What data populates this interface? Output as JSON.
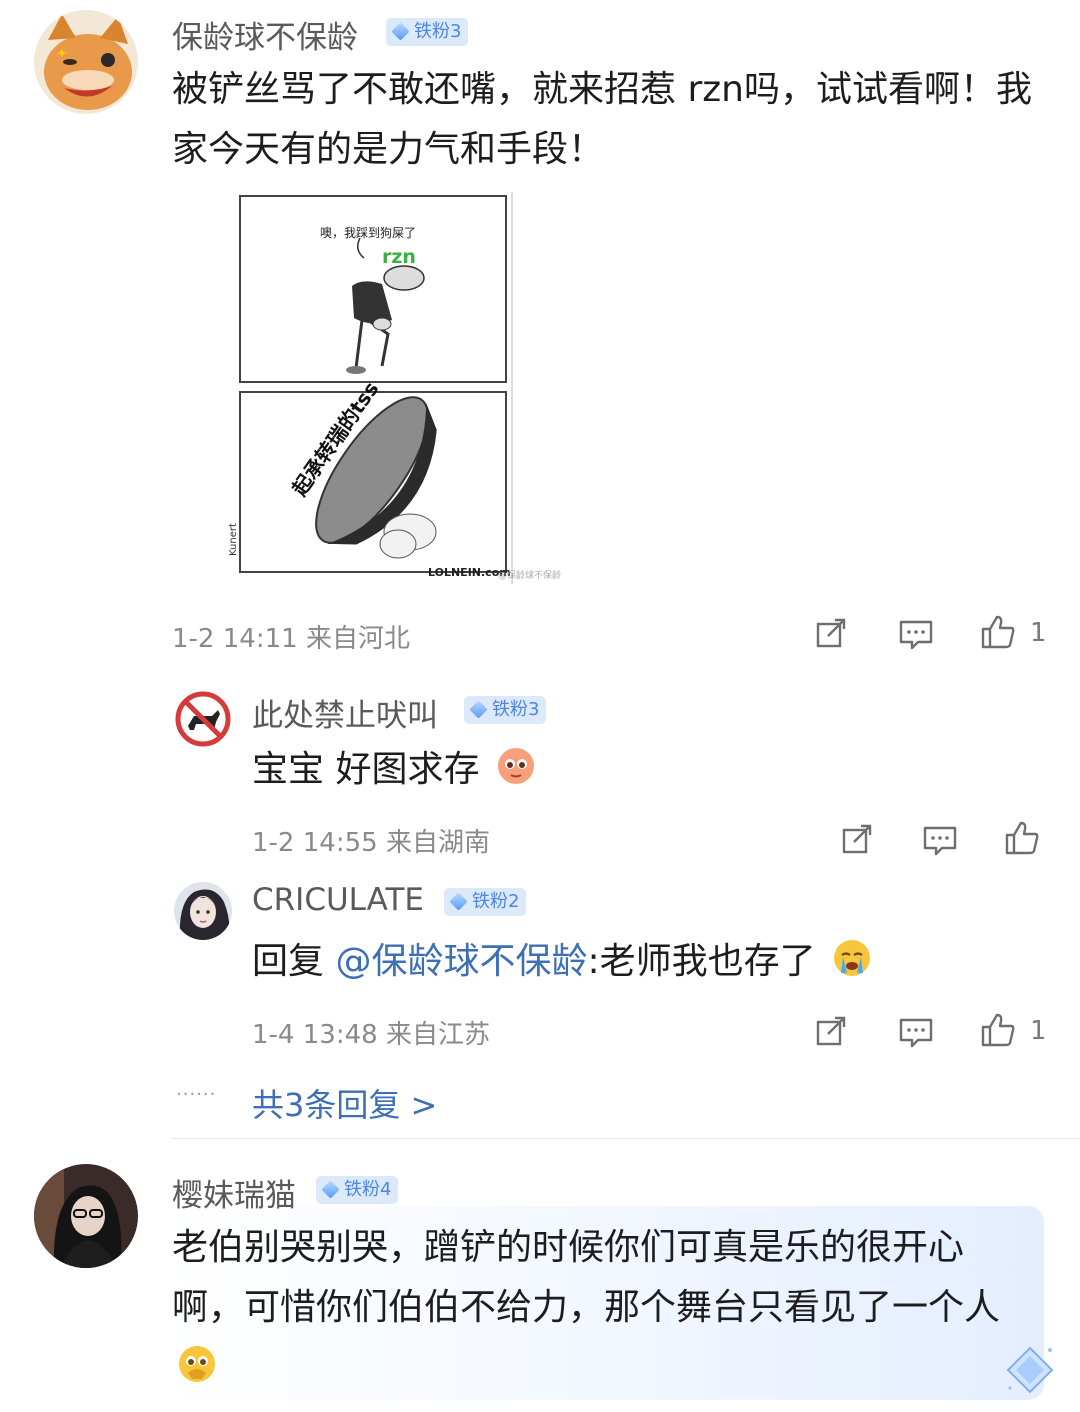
{
  "comments": [
    {
      "name": "保龄球不保龄",
      "badge": "铁粉3",
      "text": "被铲丝骂了不敢还嘴，就来招惹 rzn吗，试试看啊！我家今天有的是力气和手段！",
      "time": "1-2 14:11",
      "location": "来自河北",
      "likes": "1",
      "image": {
        "panel1_speech": "噢，我踩到狗屎了",
        "panel1_tag": "rzn",
        "panel2_shoe": "起承转瑞的tss",
        "signature": "Kunert",
        "site": "LOLNEIN.com",
        "watermark": "@保龄球不保龄"
      }
    },
    {
      "name": "樱妹瑞猫",
      "badge": "铁粉4",
      "text": "老伯别哭别哭，蹭铲的时候你们可真是乐的很开心啊，可惜你们伯伯不给力，那个舞台只看见了一个人"
    }
  ],
  "replies": [
    {
      "name": "此处禁止吠叫",
      "badge": "铁粉3",
      "text": "宝宝 好图求存",
      "time": "1-2 14:55",
      "location": "来自湖南",
      "likes": ""
    },
    {
      "name": "CRICULATE",
      "badge": "铁粉2",
      "reply_prefix": "回复 ",
      "mention": "@保龄球不保龄",
      "text": ":老师我也存了",
      "time": "1-4 13:48",
      "location": "来自江苏",
      "likes": "1"
    }
  ],
  "more_replies": {
    "dots": "······",
    "label": "共3条回复 >"
  },
  "colors": {
    "accent": "#3d6fb6",
    "badge_bg": "#dbe9fb",
    "badge_text": "#4e86e0",
    "highlight_bg": "#eaf2ff"
  }
}
